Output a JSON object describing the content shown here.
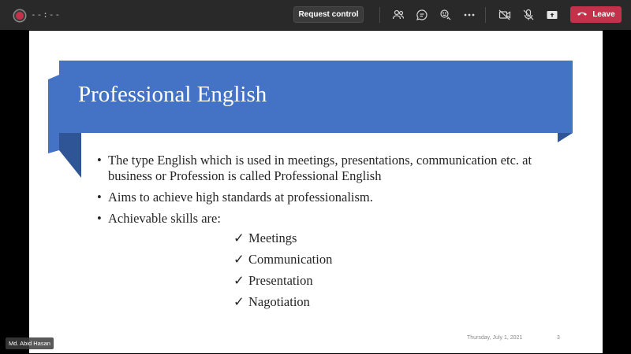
{
  "toolbar": {
    "timer": "--:--",
    "request_control_label": "Request control",
    "leave_label": "Leave",
    "icons": [
      "participants-icon",
      "chat-icon",
      "reactions-icon",
      "more-icon",
      "camera-off-icon",
      "mic-off-icon",
      "share-icon",
      "phone-icon"
    ]
  },
  "colors": {
    "toolbar_bg": "#292929",
    "leave_red": "#c4314b",
    "slide_title_blue": "#4472c4",
    "slide_fold_dark_blue": "#1f3864"
  },
  "slide": {
    "title": "Professional English",
    "bullets": [
      "The type English which is used in meetings, presentations, communication etc. at business or Profession is called Professional English",
      "Aims to achieve high standards at professionalism.",
      "Achievable skills are:"
    ],
    "bullet_symbol": "•",
    "check_symbol": "✓",
    "skills": [
      "Meetings",
      "Communication",
      "Presentation",
      "Nagotiation"
    ],
    "footer_date": "Thursday, July 1, 2021",
    "page_number": "3"
  },
  "presenter": {
    "name": "Md. Abid Hasan"
  }
}
